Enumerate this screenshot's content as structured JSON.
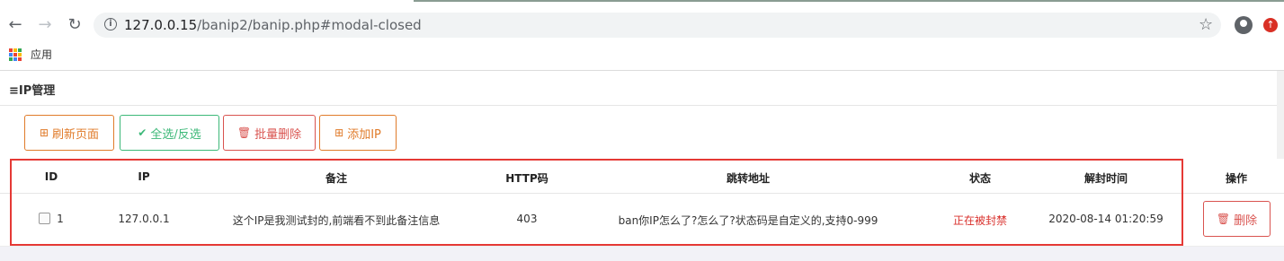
{
  "browser": {
    "url_host": "127.0.0.15",
    "url_path": "/banip2/banip.php#modal-closed",
    "bookmarks_label": "应用"
  },
  "page": {
    "title": "IP管理"
  },
  "toolbar": {
    "refresh_label": "刷新页面",
    "select_label": "全选/反选",
    "batch_delete_label": "批量删除",
    "add_label": "添加IP"
  },
  "table": {
    "headers": {
      "id": "ID",
      "ip": "IP",
      "note": "备注",
      "http": "HTTP码",
      "redirect": "跳转地址",
      "status": "状态",
      "unban_time": "解封时间",
      "actions": "操作"
    },
    "rows": [
      {
        "id": "1",
        "ip": "127.0.0.1",
        "note": "这个IP是我测试封的,前端看不到此备注信息",
        "http": "403",
        "redirect": "ban你IP怎么了?怎么了?状态码是自定义的,支持0-999",
        "status": "正在被封禁",
        "unban_time": "2020-08-14 01:20:59",
        "delete_label": "删除"
      }
    ]
  },
  "colors": {
    "warning": "#e07b2a",
    "success": "#3cb878",
    "danger": "#d9534f",
    "highlight": "#e53935"
  }
}
